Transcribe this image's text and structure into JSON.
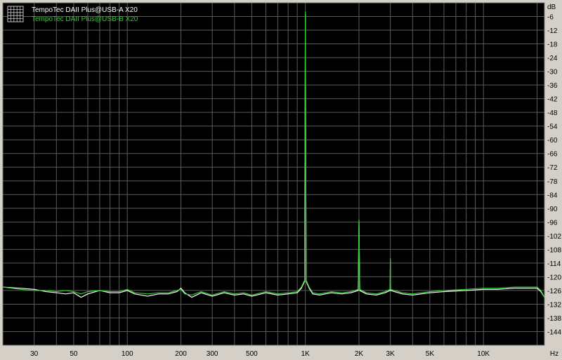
{
  "chart_data": {
    "type": "line",
    "x_unit": "Hz",
    "y_unit": "dB",
    "x_scale": "log",
    "xlim": [
      20,
      22000
    ],
    "ylim": [
      -150,
      0
    ],
    "grid": true,
    "legend_position": "top-left",
    "background": "#000000",
    "y_ticks": [
      {
        "value": -6,
        "label": "-6"
      },
      {
        "value": -12,
        "label": "-12"
      },
      {
        "value": -18,
        "label": "-18"
      },
      {
        "value": -24,
        "label": "-24"
      },
      {
        "value": -30,
        "label": "-30"
      },
      {
        "value": -36,
        "label": "-36"
      },
      {
        "value": -42,
        "label": "-42"
      },
      {
        "value": -48,
        "label": "-48"
      },
      {
        "value": -54,
        "label": "-54"
      },
      {
        "value": -60,
        "label": "-60"
      },
      {
        "value": -66,
        "label": "-66"
      },
      {
        "value": -72,
        "label": "-72"
      },
      {
        "value": -78,
        "label": "-78"
      },
      {
        "value": -84,
        "label": "-84"
      },
      {
        "value": -90,
        "label": "-90"
      },
      {
        "value": -96,
        "label": "-96"
      },
      {
        "value": -102,
        "label": "-102"
      },
      {
        "value": -108,
        "label": "-108"
      },
      {
        "value": -114,
        "label": "-114"
      },
      {
        "value": -120,
        "label": "-120"
      },
      {
        "value": -126,
        "label": "-126"
      },
      {
        "value": -132,
        "label": "-132"
      },
      {
        "value": -138,
        "label": "-138"
      },
      {
        "value": -144,
        "label": "-144"
      }
    ],
    "x_ticks": [
      {
        "value": 30,
        "label": "30"
      },
      {
        "value": 50,
        "label": "50"
      },
      {
        "value": 100,
        "label": "100"
      },
      {
        "value": 200,
        "label": "200"
      },
      {
        "value": 300,
        "label": "300"
      },
      {
        "value": 500,
        "label": "500"
      },
      {
        "value": 1000,
        "label": "1K"
      },
      {
        "value": 2000,
        "label": "2K"
      },
      {
        "value": 3000,
        "label": "3K"
      },
      {
        "value": 5000,
        "label": "5K"
      },
      {
        "value": 10000,
        "label": "10K"
      }
    ],
    "series": [
      {
        "name": "TempoTec DAII Plus@USB-A X20",
        "color": "#ffffff",
        "points": [
          [
            20,
            -124.5
          ],
          [
            25,
            -125
          ],
          [
            30,
            -125.5
          ],
          [
            35,
            -126.5
          ],
          [
            40,
            -127
          ],
          [
            45,
            -127.5
          ],
          [
            50,
            -127
          ],
          [
            55,
            -129
          ],
          [
            60,
            -127.5
          ],
          [
            70,
            -126
          ],
          [
            80,
            -127
          ],
          [
            90,
            -127
          ],
          [
            100,
            -126
          ],
          [
            110,
            -127.5
          ],
          [
            130,
            -128.5
          ],
          [
            150,
            -127.5
          ],
          [
            170,
            -127.5
          ],
          [
            190,
            -126.5
          ],
          [
            200,
            -125
          ],
          [
            210,
            -127
          ],
          [
            230,
            -129
          ],
          [
            260,
            -127
          ],
          [
            300,
            -128.5
          ],
          [
            350,
            -127
          ],
          [
            400,
            -128
          ],
          [
            450,
            -127.5
          ],
          [
            500,
            -128.5
          ],
          [
            600,
            -127
          ],
          [
            700,
            -128
          ],
          [
            800,
            -127.5
          ],
          [
            900,
            -127
          ],
          [
            950,
            -125
          ],
          [
            990,
            -122
          ],
          [
            1000,
            -5
          ],
          [
            1010,
            -122
          ],
          [
            1050,
            -125
          ],
          [
            1100,
            -127.5
          ],
          [
            1200,
            -128
          ],
          [
            1400,
            -127
          ],
          [
            1600,
            -127.5
          ],
          [
            1800,
            -127
          ],
          [
            1980,
            -126
          ],
          [
            2000,
            -96
          ],
          [
            2020,
            -126
          ],
          [
            2200,
            -127.5
          ],
          [
            2500,
            -128
          ],
          [
            2800,
            -127
          ],
          [
            2990,
            -126
          ],
          [
            3000,
            -113
          ],
          [
            3010,
            -126
          ],
          [
            3500,
            -127.5
          ],
          [
            4000,
            -128
          ],
          [
            5000,
            -127
          ],
          [
            6000,
            -126.5
          ],
          [
            8000,
            -126
          ],
          [
            10000,
            -125.5
          ],
          [
            12000,
            -125.5
          ],
          [
            15000,
            -125
          ],
          [
            18000,
            -125
          ],
          [
            20000,
            -125
          ],
          [
            21000,
            -126.5
          ],
          [
            22000,
            -129
          ]
        ]
      },
      {
        "name": "TempoTec DAII Plus@USB-B X20",
        "color": "#33cc33",
        "points": [
          [
            20,
            -124.5
          ],
          [
            25,
            -125.5
          ],
          [
            30,
            -126
          ],
          [
            35,
            -126
          ],
          [
            40,
            -126.5
          ],
          [
            45,
            -126
          ],
          [
            50,
            -126.5
          ],
          [
            55,
            -127.5
          ],
          [
            60,
            -126.5
          ],
          [
            70,
            -126
          ],
          [
            80,
            -126.5
          ],
          [
            90,
            -126.5
          ],
          [
            100,
            -125.5
          ],
          [
            110,
            -127
          ],
          [
            130,
            -127.5
          ],
          [
            150,
            -127
          ],
          [
            170,
            -127
          ],
          [
            190,
            -126
          ],
          [
            200,
            -125.5
          ],
          [
            210,
            -127.5
          ],
          [
            230,
            -128
          ],
          [
            260,
            -126.5
          ],
          [
            300,
            -128
          ],
          [
            350,
            -126.5
          ],
          [
            400,
            -127.5
          ],
          [
            450,
            -127
          ],
          [
            500,
            -128
          ],
          [
            600,
            -126.5
          ],
          [
            700,
            -127.5
          ],
          [
            800,
            -127
          ],
          [
            900,
            -126.5
          ],
          [
            950,
            -124.5
          ],
          [
            990,
            -121.5
          ],
          [
            1000,
            -4
          ],
          [
            1010,
            -121.5
          ],
          [
            1050,
            -124.5
          ],
          [
            1100,
            -127
          ],
          [
            1200,
            -127.5
          ],
          [
            1400,
            -126.5
          ],
          [
            1600,
            -127
          ],
          [
            1800,
            -126.5
          ],
          [
            1980,
            -125.5
          ],
          [
            2000,
            -95
          ],
          [
            2020,
            -125.5
          ],
          [
            2200,
            -127
          ],
          [
            2500,
            -127.5
          ],
          [
            2800,
            -126.5
          ],
          [
            2990,
            -125.5
          ],
          [
            3000,
            -112
          ],
          [
            3010,
            -125.5
          ],
          [
            3500,
            -127
          ],
          [
            4000,
            -127.5
          ],
          [
            5000,
            -126.5
          ],
          [
            6000,
            -126
          ],
          [
            8000,
            -125.5
          ],
          [
            10000,
            -125
          ],
          [
            12000,
            -125
          ],
          [
            15000,
            -124.5
          ],
          [
            18000,
            -124.5
          ],
          [
            20000,
            -124.5
          ],
          [
            21000,
            -126
          ],
          [
            22000,
            -129
          ]
        ]
      }
    ]
  }
}
